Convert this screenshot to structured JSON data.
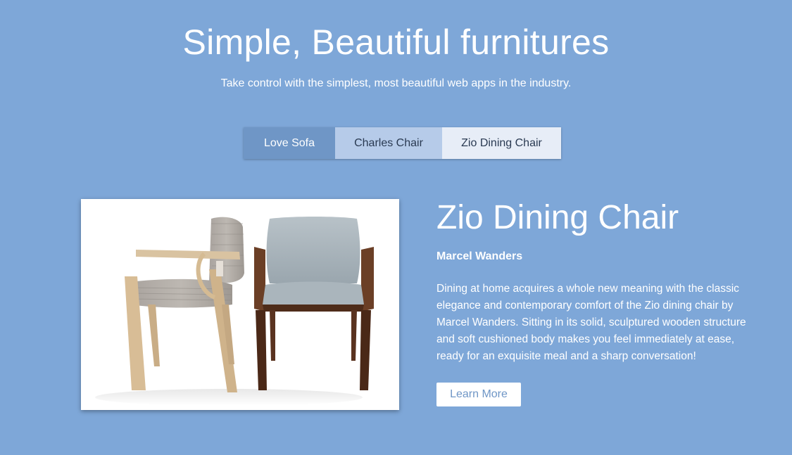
{
  "hero": {
    "title": "Simple, Beautiful furnitures",
    "subtitle": "Take control with the simplest, most beautiful web apps in the industry."
  },
  "tabs": [
    {
      "label": "Love Sofa"
    },
    {
      "label": "Charles Chair"
    },
    {
      "label": "Zio Dining Chair"
    }
  ],
  "product": {
    "name": "Zio Dining Chair",
    "designer": "Marcel Wanders",
    "description": "Dining at home acquires a whole new meaning with the classic elegance and contemporary comfort of the Zio dining chair by Marcel Wanders. Sitting in its solid, sculptured wooden structure and soft cushioned body makes you feel immediately at ease, ready for an exquisite meal and a sharp conversation!",
    "button_label": "Learn More"
  },
  "colors": {
    "background": "#7ea7d8",
    "tab_active": "#6f96c6",
    "tab_mid": "#b6cbe9",
    "tab_light": "#e7edf7",
    "button_text": "#6f96c6"
  }
}
